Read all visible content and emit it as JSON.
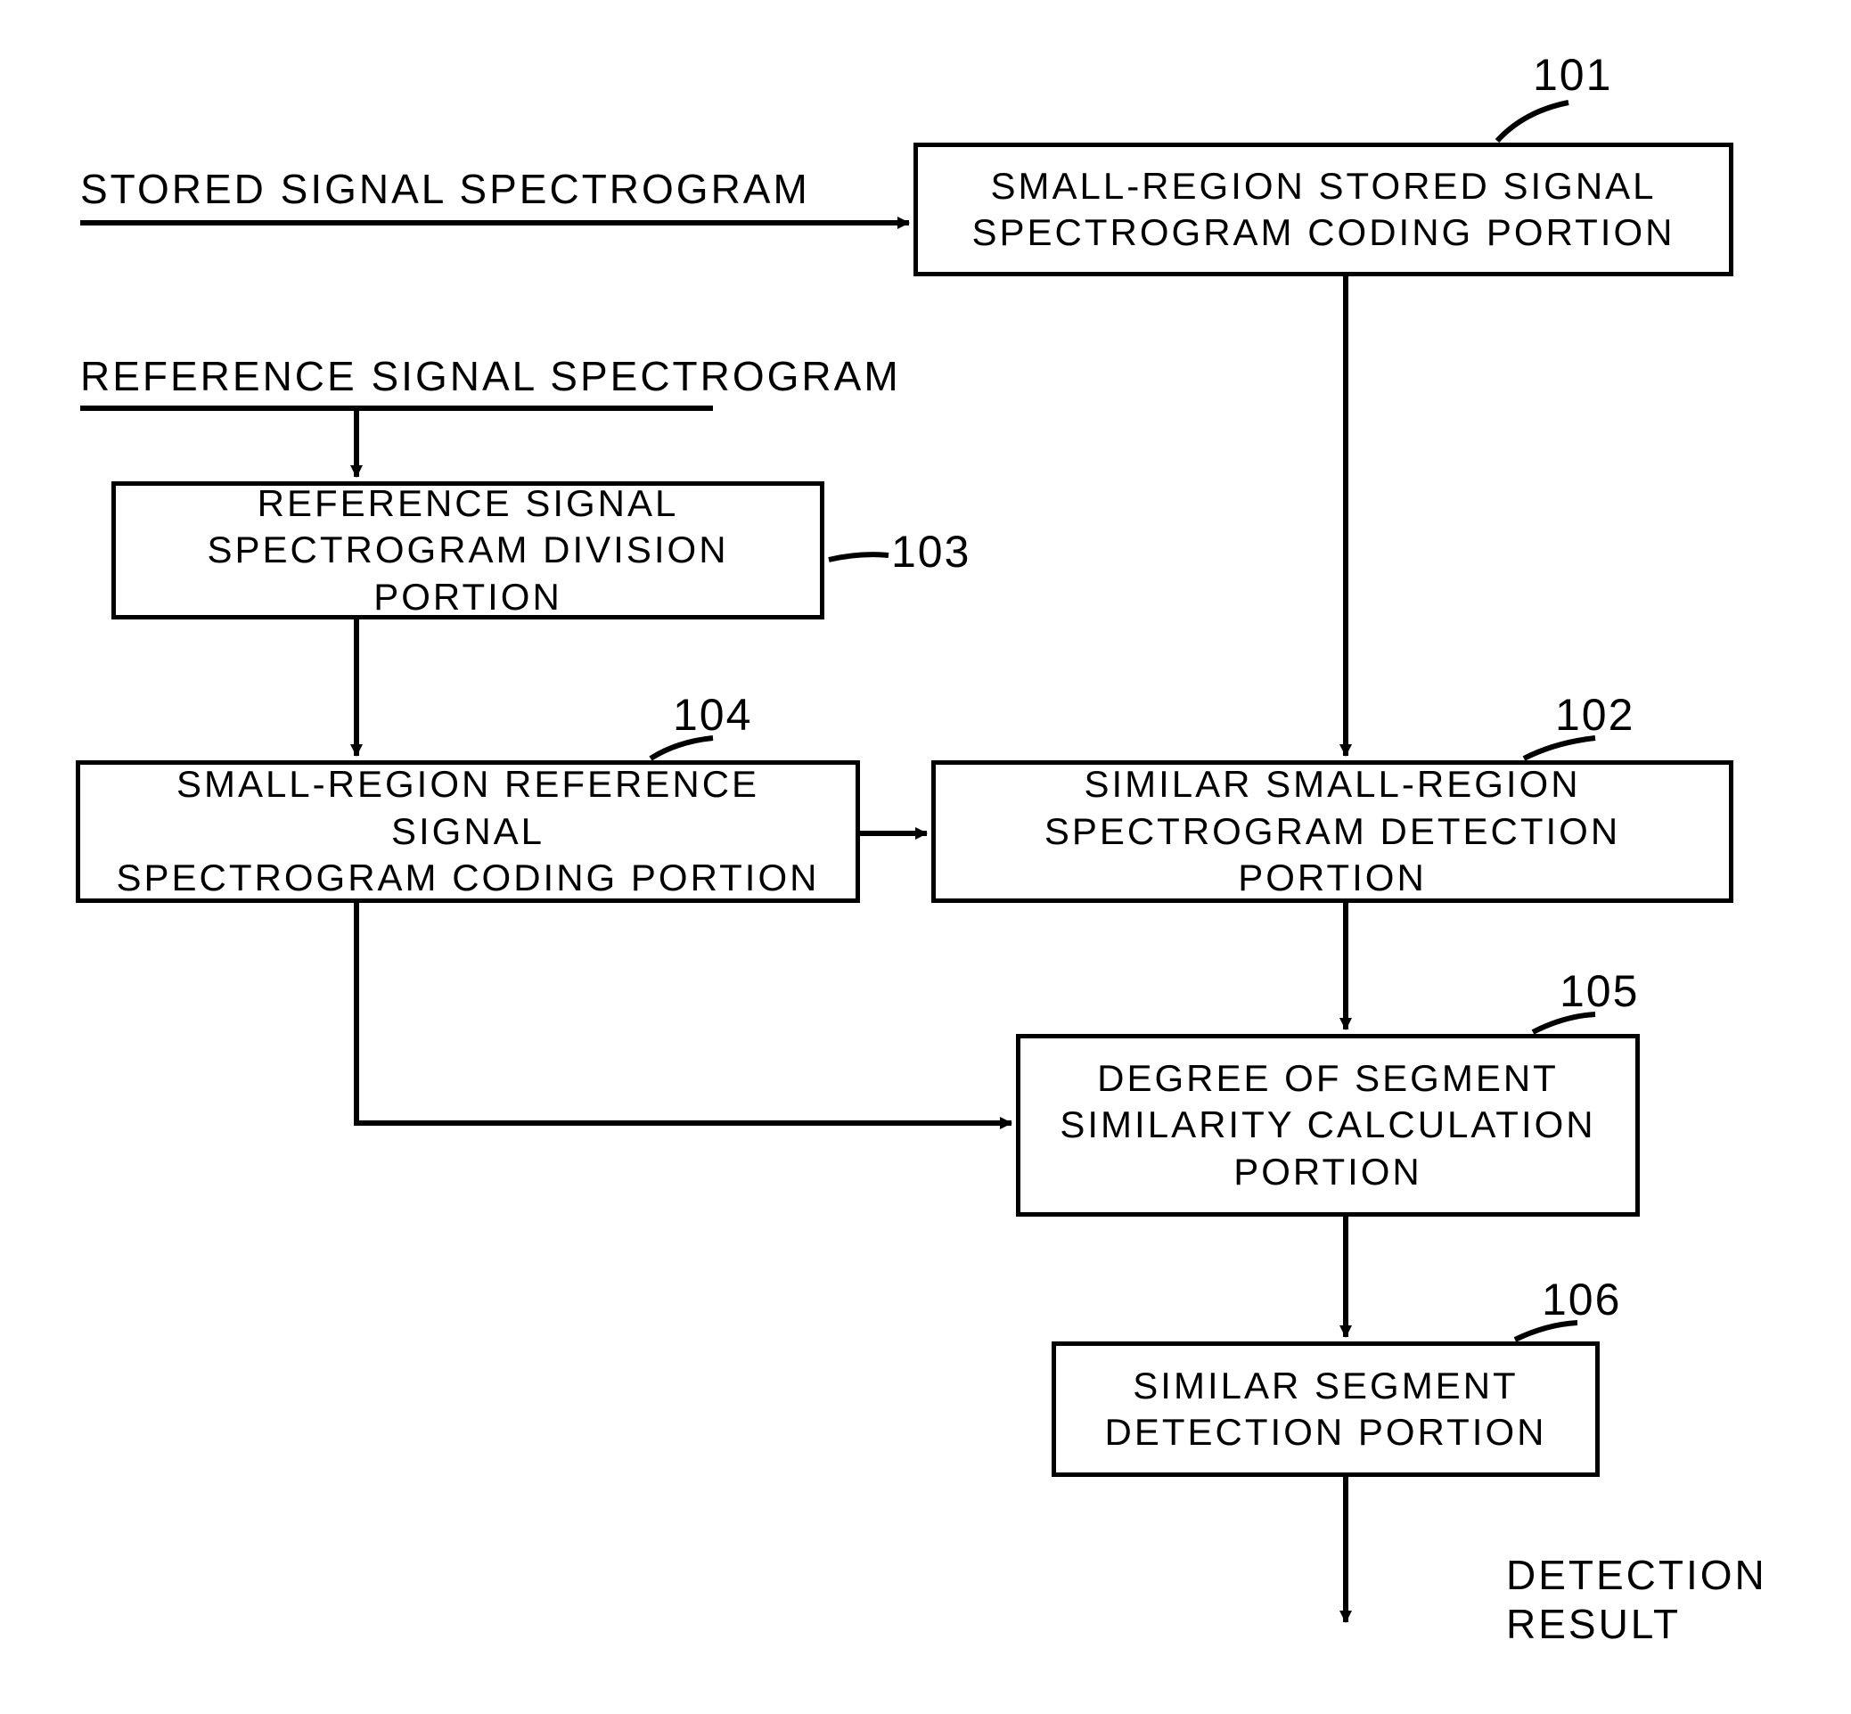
{
  "inputs": {
    "stored": "STORED SIGNAL SPECTROGRAM",
    "reference": "REFERENCE SIGNAL SPECTROGRAM"
  },
  "boxes": {
    "b101": "SMALL-REGION STORED SIGNAL\nSPECTROGRAM CODING PORTION",
    "n101": "101",
    "b103": "REFERENCE SIGNAL\nSPECTROGRAM DIVISION PORTION",
    "n103": "103",
    "b104": "SMALL-REGION REFERENCE SIGNAL\nSPECTROGRAM CODING PORTION",
    "n104": "104",
    "b102": "SIMILAR SMALL-REGION\nSPECTROGRAM DETECTION PORTION",
    "n102": "102",
    "b105": "DEGREE OF SEGMENT\nSIMILARITY CALCULATION\nPORTION",
    "n105": "105",
    "b106": "SIMILAR SEGMENT\nDETECTION PORTION",
    "n106": "106"
  },
  "output": "DETECTION\nRESULT"
}
